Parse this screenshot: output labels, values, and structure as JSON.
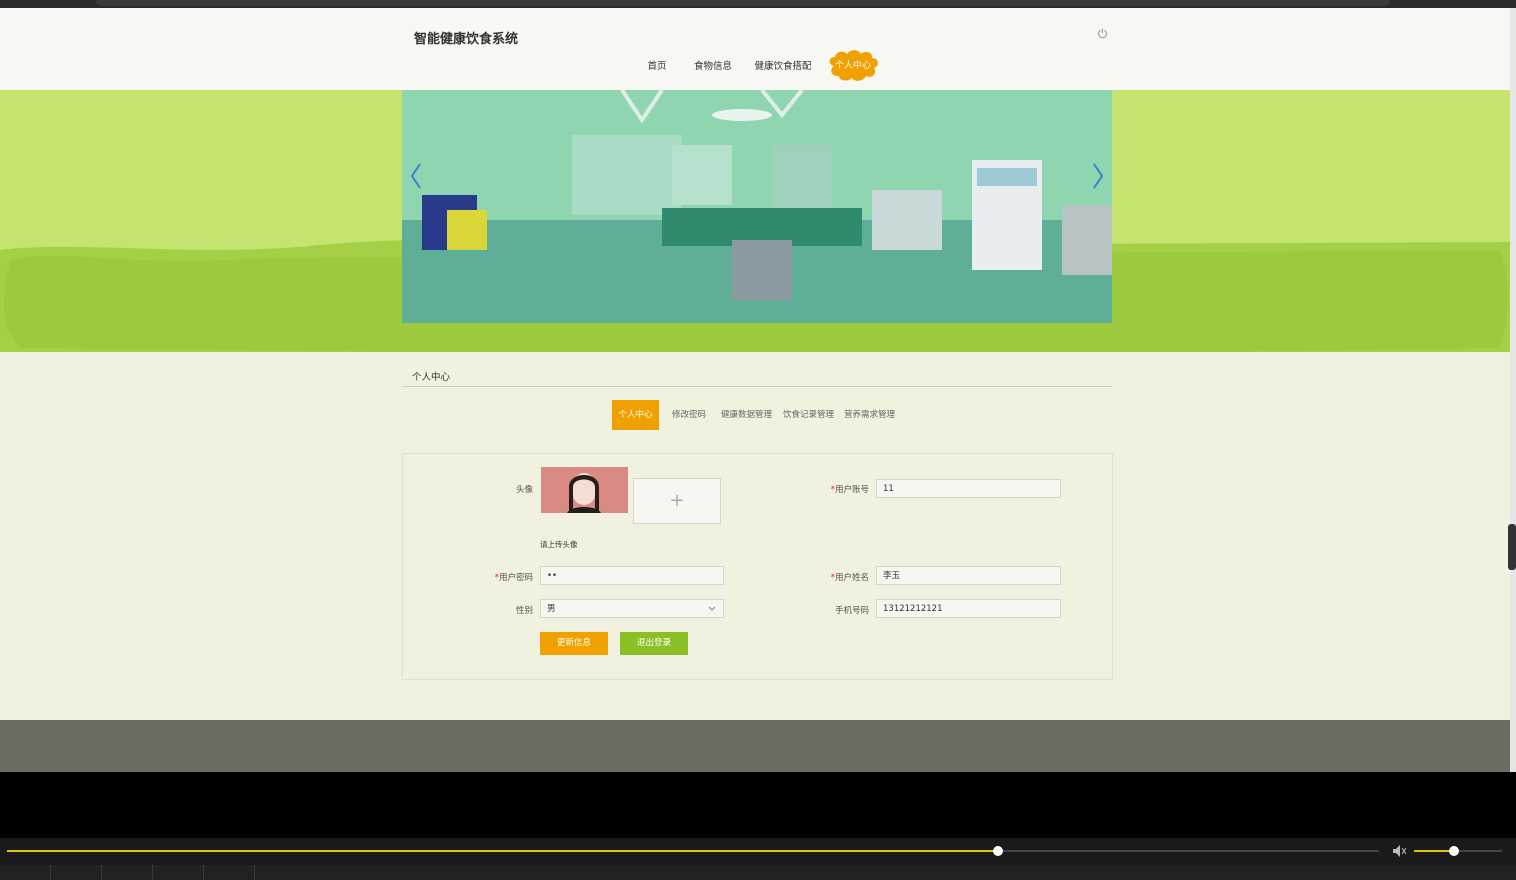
{
  "header": {
    "site_title": "智能健康饮食系统",
    "nav": [
      "首页",
      "食物信息",
      "健康饮食搭配",
      "个人中心"
    ],
    "active_nav": "个人中心"
  },
  "section": {
    "title": "个人中心",
    "tabs": [
      "个人中心",
      "修改密码",
      "健康数据管理",
      "饮食记录管理",
      "营养需求管理"
    ],
    "active_tab": "个人中心"
  },
  "form": {
    "avatar_label": "头像",
    "upload_icon": "+",
    "upload_hint": "请上传头像",
    "account_label": "用户账号",
    "account_value": "11",
    "password_label": "用户密码",
    "password_value": "••",
    "name_label": "用户姓名",
    "name_value": "李玉",
    "gender_label": "性别",
    "gender_value": "男",
    "phone_label": "手机号码",
    "phone_value": "13121212121",
    "update_button": "更新信息",
    "logout_button": "退出登录"
  },
  "player": {
    "progress": 0.722,
    "volume": 0.45
  },
  "colors": {
    "accent_orange": "#f0a000",
    "accent_green": "#8cbf26",
    "banner_green": "#c3e46f",
    "page_bg": "#f0f1de",
    "seek_yellow": "#e8c200"
  }
}
